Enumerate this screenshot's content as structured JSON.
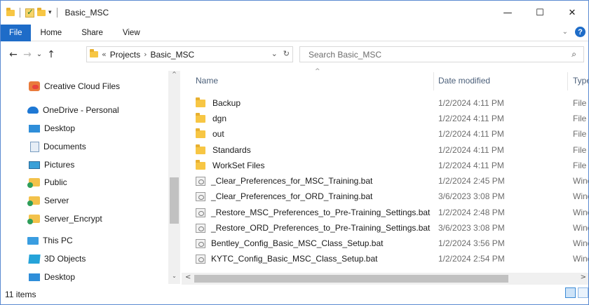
{
  "window": {
    "title": "Basic_MSC",
    "controls": {
      "minimize": "—",
      "maximize": "☐",
      "close": "✕"
    }
  },
  "quick_access": {
    "dropdown": "▾"
  },
  "ribbon": {
    "tabs": [
      "File",
      "Home",
      "Share",
      "View"
    ],
    "expand": "⌄",
    "help": "?"
  },
  "nav_buttons": {
    "back": "←",
    "forward": "→",
    "recent": "⌄",
    "up": "↑"
  },
  "address": {
    "overflow": "«",
    "crumbs": [
      "Projects",
      "Basic_MSC"
    ],
    "separator": "›",
    "dropdown": "⌄",
    "refresh": "↻"
  },
  "search": {
    "placeholder": "Search Basic_MSC",
    "icon": "search-icon"
  },
  "nav_pane": {
    "items": [
      {
        "label": "Creative Cloud Files",
        "icon": "creative-cloud-icon"
      },
      {
        "label": "OneDrive - Personal",
        "icon": "onedrive-cloud-icon"
      },
      {
        "label": "Desktop",
        "icon": "desktop-icon"
      },
      {
        "label": "Documents",
        "icon": "documents-icon"
      },
      {
        "label": "Pictures",
        "icon": "pictures-icon"
      },
      {
        "label": "Public",
        "icon": "shared-folder-icon"
      },
      {
        "label": "Server",
        "icon": "shared-folder-icon"
      },
      {
        "label": "Server_Encrypt",
        "icon": "shared-folder-icon"
      },
      {
        "label": "This PC",
        "icon": "this-pc-icon"
      },
      {
        "label": "3D Objects",
        "icon": "3d-objects-icon"
      },
      {
        "label": "Desktop",
        "icon": "desktop-icon"
      }
    ]
  },
  "file_list": {
    "columns": {
      "name": "Name",
      "date": "Date modified",
      "type": "Type"
    },
    "sort_indicator": "^",
    "rows": [
      {
        "name": "Backup",
        "date": "1/2/2024 4:11 PM",
        "type": "File f",
        "icon": "folder-icon"
      },
      {
        "name": "dgn",
        "date": "1/2/2024 4:11 PM",
        "type": "File f",
        "icon": "folder-icon"
      },
      {
        "name": "out",
        "date": "1/2/2024 4:11 PM",
        "type": "File f",
        "icon": "folder-icon"
      },
      {
        "name": "Standards",
        "date": "1/2/2024 4:11 PM",
        "type": "File f",
        "icon": "folder-icon"
      },
      {
        "name": "WorkSet Files",
        "date": "1/2/2024 4:11 PM",
        "type": "File f",
        "icon": "folder-icon"
      },
      {
        "name": "_Clear_Preferences_for_MSC_Training.bat",
        "date": "1/2/2024 2:45 PM",
        "type": "Wind",
        "icon": "batch-file-icon"
      },
      {
        "name": "_Clear_Preferences_for_ORD_Training.bat",
        "date": "3/6/2023 3:08 PM",
        "type": "Wind",
        "icon": "batch-file-icon"
      },
      {
        "name": "_Restore_MSC_Preferences_to_Pre-Training_Settings.bat",
        "date": "1/2/2024 2:48 PM",
        "type": "Wind",
        "icon": "batch-file-icon"
      },
      {
        "name": "_Restore_ORD_Preferences_to_Pre-Training_Settings.bat",
        "date": "3/6/2023 3:08 PM",
        "type": "Wind",
        "icon": "batch-file-icon"
      },
      {
        "name": "Bentley_Config_Basic_MSC_Class_Setup.bat",
        "date": "1/2/2024 3:56 PM",
        "type": "Wind",
        "icon": "batch-file-icon"
      },
      {
        "name": "KYTC_Config_Basic_MSC_Class_Setup.bat",
        "date": "1/2/2024 2:54 PM",
        "type": "Wind",
        "icon": "batch-file-icon"
      }
    ]
  },
  "scrollbars": {
    "left": "<",
    "right": ">",
    "up": "^",
    "down": "⌄"
  },
  "status": {
    "item_count": "11 items"
  }
}
